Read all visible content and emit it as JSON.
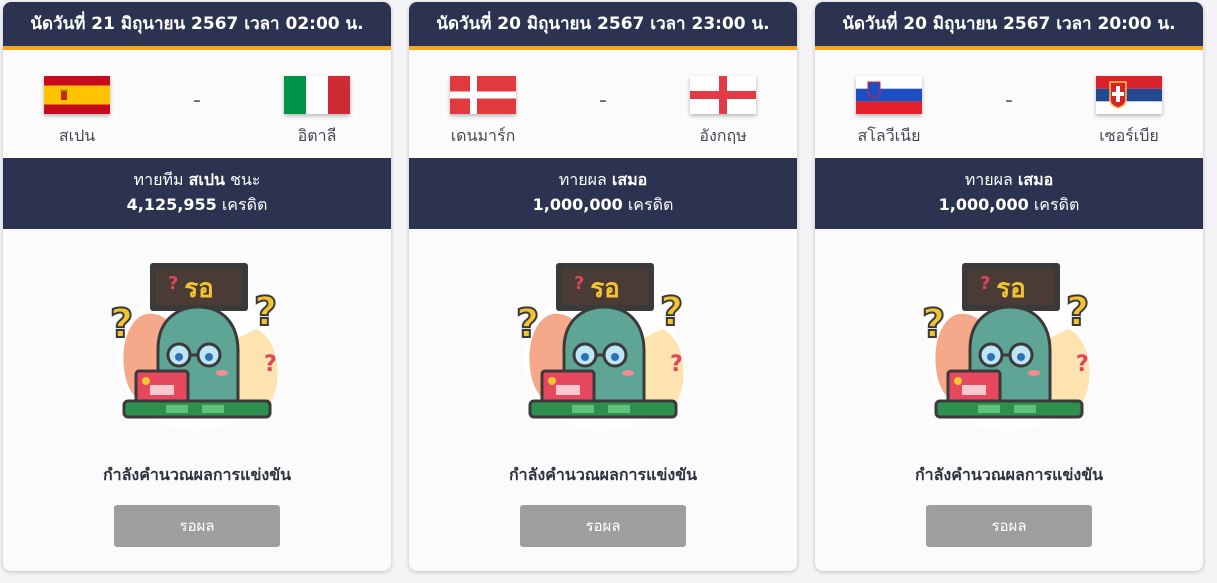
{
  "matches": [
    {
      "header": "นัดวันที่ 21 มิถุนายน 2567 เวลา 02:00 น.",
      "home": {
        "name": "สเปน",
        "flag": "spain-flag-icon"
      },
      "away": {
        "name": "อิตาลี",
        "flag": "italy-flag-icon"
      },
      "separator": "-",
      "prediction_prefix": "ทายทีม",
      "prediction_value": "สเปน",
      "prediction_suffix": "ชนะ",
      "credits_amount": "4,125,955",
      "credits_unit": "เครดิต",
      "mascot_sign": "รอ",
      "status": "กำลังคำนวณผลการแข่งขัน",
      "button_label": "รอผล"
    },
    {
      "header": "นัดวันที่ 20 มิถุนายน 2567 เวลา 23:00 น.",
      "home": {
        "name": "เดนมาร์ก",
        "flag": "denmark-flag-icon"
      },
      "away": {
        "name": "อังกฤษ",
        "flag": "england-flag-icon"
      },
      "separator": "-",
      "prediction_prefix": "ทายผล",
      "prediction_value": "เสมอ",
      "prediction_suffix": "",
      "credits_amount": "1,000,000",
      "credits_unit": "เครดิต",
      "mascot_sign": "รอ",
      "status": "กำลังคำนวณผลการแข่งขัน",
      "button_label": "รอผล"
    },
    {
      "header": "นัดวันที่ 20 มิถุนายน 2567 เวลา 20:00 น.",
      "home": {
        "name": "สโลวีเนีย",
        "flag": "slovenia-flag-icon"
      },
      "away": {
        "name": "เซอร์เบีย",
        "flag": "serbia-flag-icon"
      },
      "separator": "-",
      "prediction_prefix": "ทายผล",
      "prediction_value": "เสมอ",
      "prediction_suffix": "",
      "credits_amount": "1,000,000",
      "credits_unit": "เครดิต",
      "mascot_sign": "รอ",
      "status": "กำลังคำนวณผลการแข่งขัน",
      "button_label": "รอผล"
    }
  ],
  "colors": {
    "header_bg": "#2b3350",
    "accent": "#f2a81d",
    "button_disabled": "#9e9e9e"
  }
}
